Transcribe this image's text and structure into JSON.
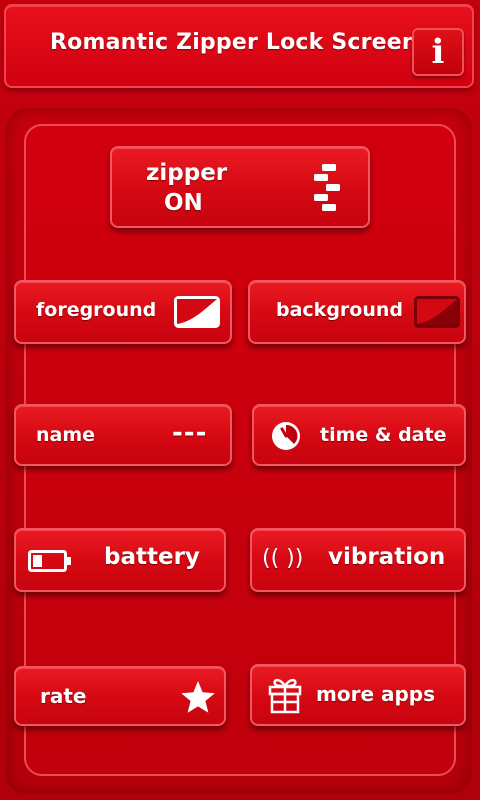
{
  "header": {
    "title": "Romantic Zipper Lock Screen",
    "info_label": "i"
  },
  "zipper": {
    "line1": "zipper",
    "line2": "ON",
    "icon": "zipper-teeth-icon"
  },
  "buttons": {
    "foreground": {
      "label": "foreground",
      "icon": "foreground-swatch-icon"
    },
    "background": {
      "label": "background",
      "icon": "background-swatch-icon"
    },
    "name": {
      "label": "name",
      "value": "---"
    },
    "time_date": {
      "label": "time & date",
      "icon": "clock-icon"
    },
    "battery": {
      "label": "battery",
      "icon": "battery-icon"
    },
    "vibration": {
      "label": "vibration",
      "icon_text": "(( ))"
    },
    "rate": {
      "label": "rate",
      "icon": "star-icon"
    },
    "more_apps": {
      "label": "more apps",
      "icon": "gift-icon"
    }
  },
  "colors": {
    "background": "#c0000c",
    "button": "#d40812",
    "border": "#f2575e",
    "text": "#ffffff"
  }
}
